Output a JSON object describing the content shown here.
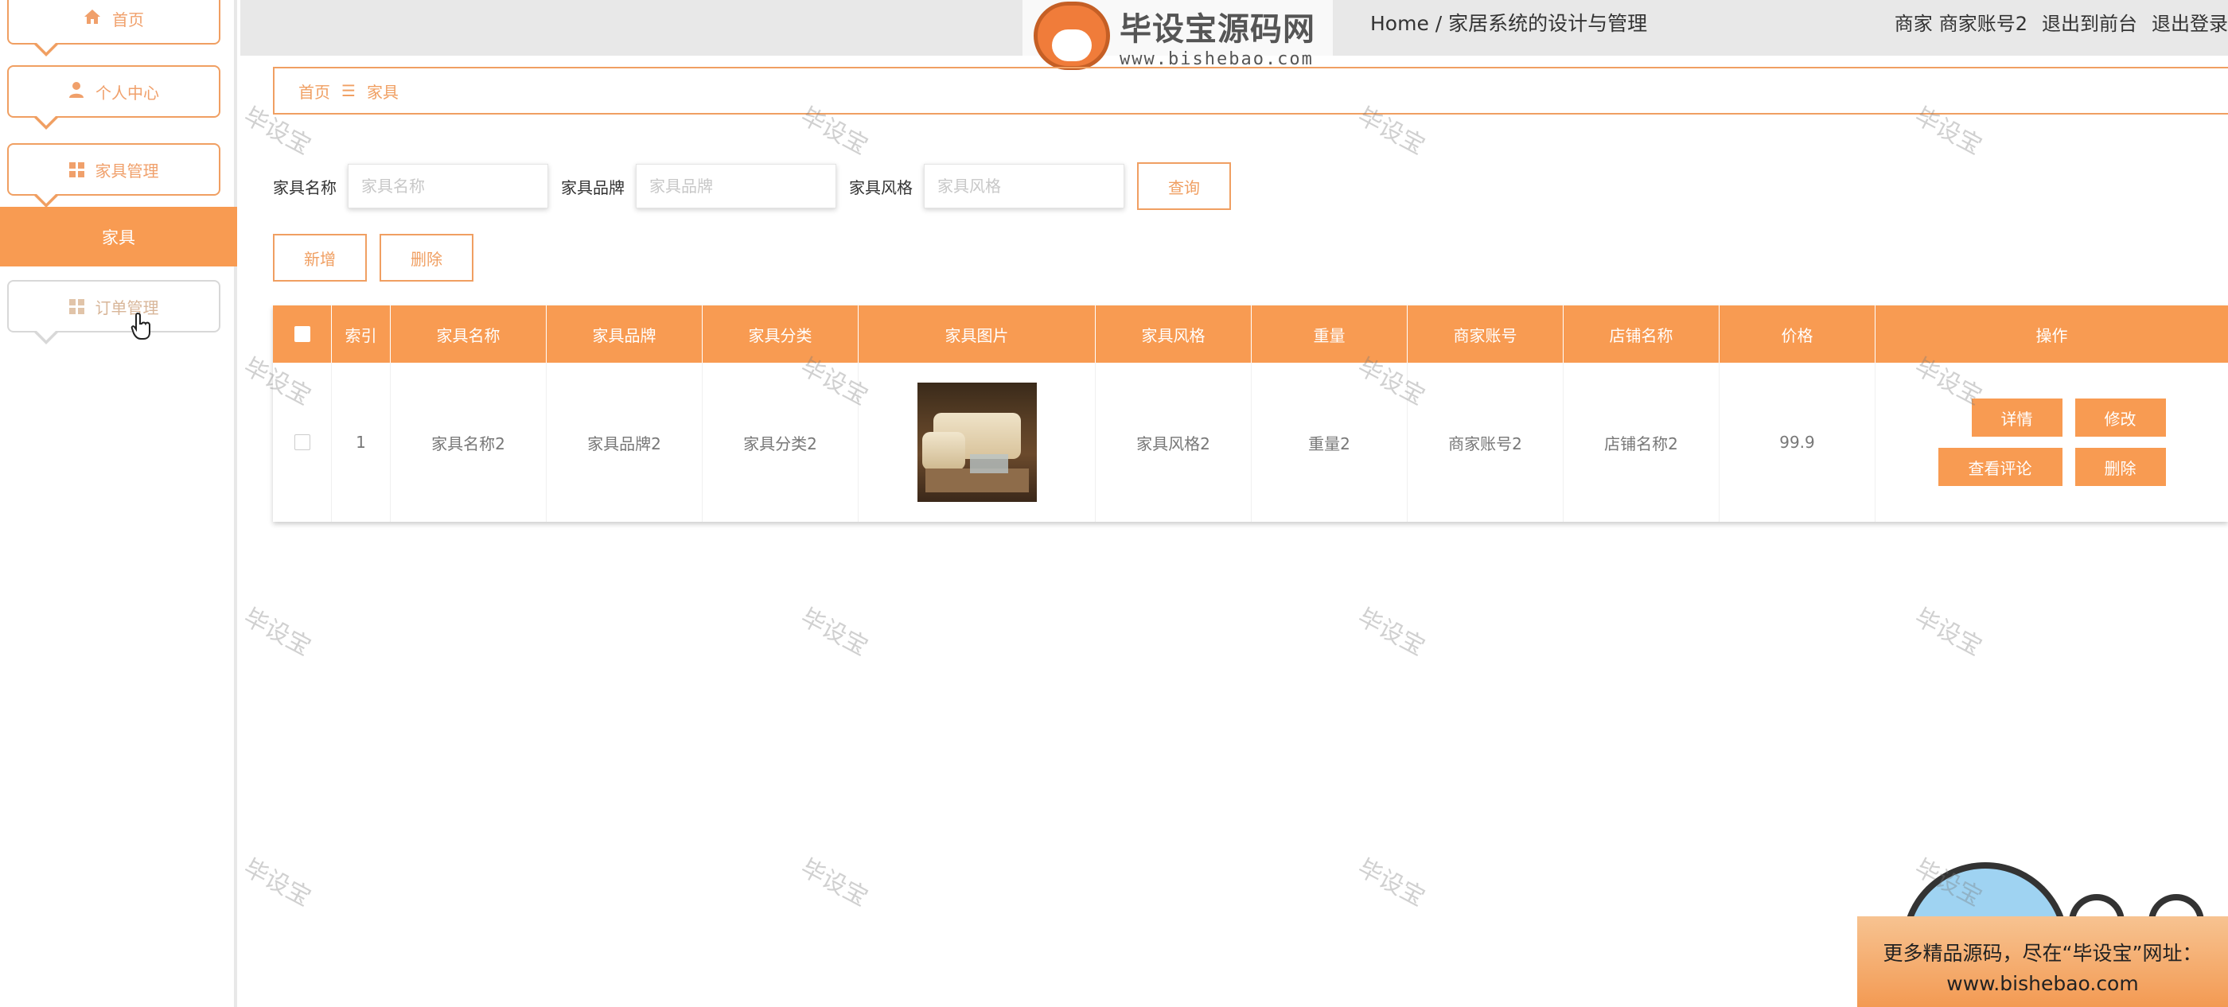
{
  "sidebar": {
    "items": [
      {
        "label": "首页",
        "icon": "home-icon"
      },
      {
        "label": "个人中心",
        "icon": "user-icon"
      },
      {
        "label": "家具管理",
        "icon": "grid-icon"
      },
      {
        "label": "家具"
      },
      {
        "label": "订单管理",
        "icon": "grid-icon"
      }
    ]
  },
  "topbar": {
    "title": "Home / 家居系统的设计与管理",
    "user_role": "商家",
    "user_name": "商家账号2",
    "to_front": "退出到前台",
    "logout": "退出登录"
  },
  "logo": {
    "badge": "毕设宝",
    "name": "毕设宝源码网",
    "url": "www.bishebao.com"
  },
  "breadcrumb": {
    "home": "首页",
    "separator": "☰",
    "current": "家具"
  },
  "search": {
    "name_label": "家具名称",
    "name_placeholder": "家具名称",
    "brand_label": "家具品牌",
    "brand_placeholder": "家具品牌",
    "style_label": "家具风格",
    "style_placeholder": "家具风格",
    "query_button": "查询"
  },
  "actions": {
    "add": "新增",
    "delete": "删除"
  },
  "table": {
    "headers": [
      "索引",
      "家具名称",
      "家具品牌",
      "家具分类",
      "家具图片",
      "家具风格",
      "重量",
      "商家账号",
      "店铺名称",
      "价格",
      "操作"
    ],
    "rows": [
      {
        "index": "1",
        "name": "家具名称2",
        "brand": "家具品牌2",
        "category": "家具分类2",
        "style": "家具风格2",
        "weight": "重量2",
        "merchant": "商家账号2",
        "shop": "店铺名称2",
        "price": "99.9",
        "ops": {
          "detail": "详情",
          "edit": "修改",
          "comments": "查看评论",
          "delete": "删除"
        }
      }
    ]
  },
  "watermark": "毕设宝",
  "promo": {
    "line1": "更多精品源码，尽在“毕设宝”网址：",
    "line2": "www.bishebao.com"
  },
  "colors": {
    "accent": "#f89b52",
    "accent_border": "#f09f62"
  }
}
